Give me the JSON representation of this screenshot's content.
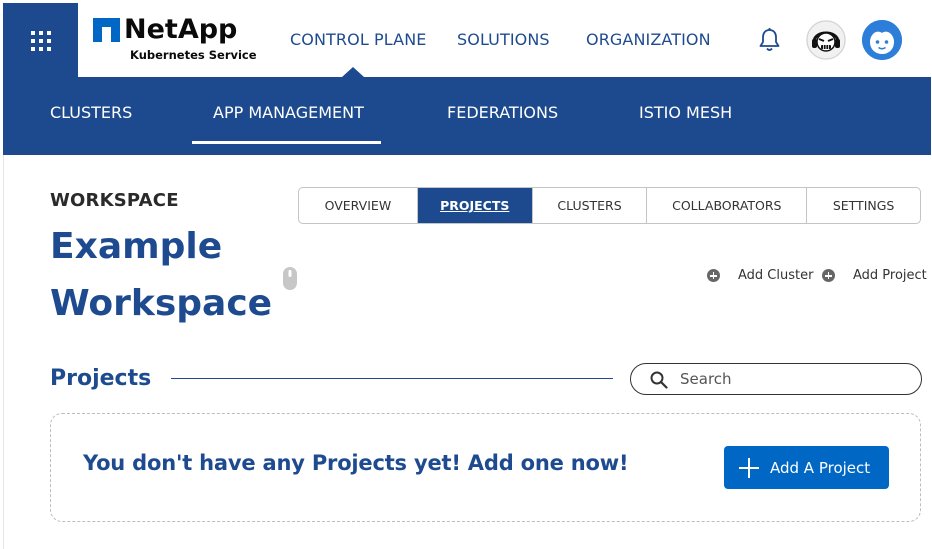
{
  "header": {
    "menu_icon": "grid-icon",
    "brand": {
      "name": "NetApp",
      "subtitle": "Kubernetes Service"
    },
    "nav": [
      "CONTROL PLANE",
      "SOLUTIONS",
      "ORGANIZATION"
    ],
    "active_nav": "CONTROL PLANE",
    "icons": [
      "bell-icon",
      "support-avatar",
      "user-avatar"
    ]
  },
  "subnav": {
    "items": [
      "CLUSTERS",
      "APP MANAGEMENT",
      "FEDERATIONS",
      "ISTIO MESH"
    ],
    "active": "APP MANAGEMENT"
  },
  "workspace": {
    "label": "WORKSPACE",
    "title": "Example Workspace"
  },
  "tabs": {
    "items": [
      "OVERVIEW",
      "PROJECTS",
      "CLUSTERS",
      "COLLABORATORS",
      "SETTINGS"
    ],
    "active": "PROJECTS"
  },
  "actions": {
    "add_cluster": "Add Cluster",
    "add_project": "Add Project"
  },
  "projects": {
    "title": "Projects",
    "search_placeholder": "Search",
    "empty_message": "You don't have any Projects yet! Add one now!",
    "add_button": "Add A Project"
  },
  "colors": {
    "primary": "#1d4a8e",
    "accent_button": "#0067c5"
  }
}
